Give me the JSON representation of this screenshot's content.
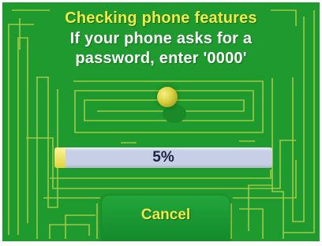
{
  "screen": {
    "title": "Checking phone features",
    "message_line1": "If your phone asks for a",
    "message_line2": "password, enter '0000'",
    "status_icon": "globe-icon"
  },
  "progress": {
    "label": "5%",
    "fraction": 0.05
  },
  "buttons": {
    "cancel_label": "Cancel"
  },
  "colors": {
    "background": "#1f9a2e",
    "maze_lines": "#b6d24a",
    "title_yellow": "#f1e94a",
    "progress_track": "#c7cfe6",
    "progress_fill": "#e1d43a"
  }
}
